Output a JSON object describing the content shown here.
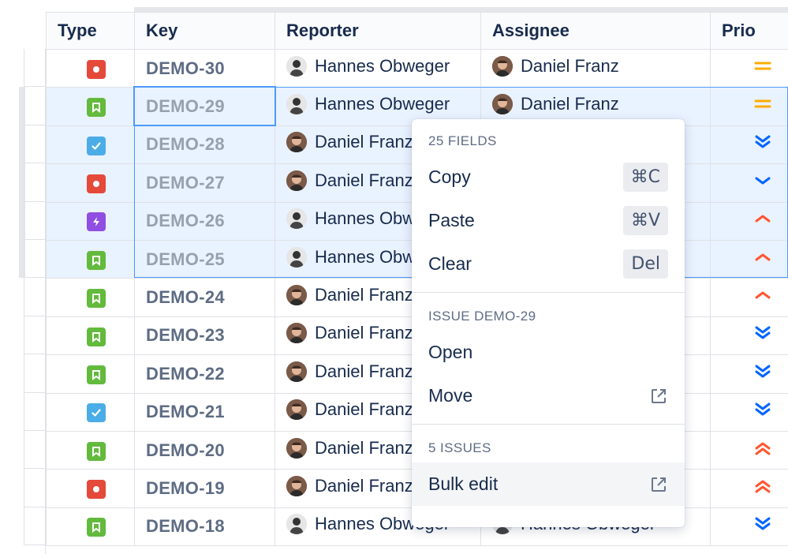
{
  "columns": {
    "type": "Type",
    "key": "Key",
    "reporter": "Reporter",
    "assignee": "Assignee",
    "priority": "Prio"
  },
  "rows": [
    {
      "type": "bug",
      "key": "DEMO-30",
      "reporter": "Hannes Obweger",
      "reporter_avatar": "hannes",
      "assignee": "Daniel Franz",
      "assignee_avatar": "daniel",
      "priority": "medium",
      "selected": false
    },
    {
      "type": "story",
      "key": "DEMO-29",
      "reporter": "Hannes Obweger",
      "reporter_avatar": "hannes",
      "assignee": "Daniel Franz",
      "assignee_avatar": "daniel",
      "priority": "medium",
      "selected": true
    },
    {
      "type": "task",
      "key": "DEMO-28",
      "reporter": "Daniel Franz",
      "reporter_avatar": "daniel",
      "assignee": "",
      "assignee_avatar": "",
      "priority": "lowest",
      "selected": true
    },
    {
      "type": "bug",
      "key": "DEMO-27",
      "reporter": "Daniel Franz",
      "reporter_avatar": "daniel",
      "assignee": "",
      "assignee_avatar": "",
      "priority": "low",
      "selected": true
    },
    {
      "type": "epic",
      "key": "DEMO-26",
      "reporter": "Hannes Obweger",
      "reporter_avatar": "hannes",
      "assignee": "",
      "assignee_avatar": "",
      "priority": "high",
      "selected": true
    },
    {
      "type": "story",
      "key": "DEMO-25",
      "reporter": "Hannes Obweger",
      "reporter_avatar": "hannes",
      "assignee": "",
      "assignee_avatar": "",
      "priority": "high",
      "selected": true
    },
    {
      "type": "story",
      "key": "DEMO-24",
      "reporter": "Daniel Franz",
      "reporter_avatar": "daniel",
      "assignee": "",
      "assignee_avatar": "",
      "priority": "high",
      "selected": false
    },
    {
      "type": "story",
      "key": "DEMO-23",
      "reporter": "Daniel Franz",
      "reporter_avatar": "daniel",
      "assignee": "",
      "assignee_avatar": "",
      "priority": "lowest",
      "selected": false
    },
    {
      "type": "story",
      "key": "DEMO-22",
      "reporter": "Daniel Franz",
      "reporter_avatar": "daniel",
      "assignee": "",
      "assignee_avatar": "",
      "priority": "lowest",
      "selected": false
    },
    {
      "type": "task",
      "key": "DEMO-21",
      "reporter": "Daniel Franz",
      "reporter_avatar": "daniel",
      "assignee": "",
      "assignee_avatar": "",
      "priority": "lowest",
      "selected": false
    },
    {
      "type": "story",
      "key": "DEMO-20",
      "reporter": "Daniel Franz",
      "reporter_avatar": "daniel",
      "assignee": "",
      "assignee_avatar": "",
      "priority": "highest",
      "selected": false
    },
    {
      "type": "bug",
      "key": "DEMO-19",
      "reporter": "Daniel Franz",
      "reporter_avatar": "daniel",
      "assignee": "",
      "assignee_avatar": "",
      "priority": "highest",
      "selected": false
    },
    {
      "type": "story",
      "key": "DEMO-18",
      "reporter": "Hannes Obweger",
      "reporter_avatar": "hannes",
      "assignee": "Hannes Obweger",
      "assignee_avatar": "hannes",
      "priority": "lowest",
      "selected": false
    }
  ],
  "context_menu": {
    "fields_heading": "25 FIELDS",
    "copy_label": "Copy",
    "copy_shortcut": "⌘C",
    "paste_label": "Paste",
    "paste_shortcut": "⌘V",
    "clear_label": "Clear",
    "clear_shortcut": "Del",
    "issue_heading": "ISSUE DEMO-29",
    "open_label": "Open",
    "move_label": "Move",
    "issues_heading": "5 ISSUES",
    "bulk_edit_label": "Bulk edit"
  },
  "colors": {
    "selection": "#4c9aff",
    "selected_row_bg": "#e9f2ff",
    "bug": "#e5493a",
    "story": "#63ba3c",
    "task": "#4bade8",
    "epic": "#904ee2",
    "priority_medium": "#ffab00",
    "priority_low": "#0065ff",
    "priority_high": "#ff5630"
  }
}
